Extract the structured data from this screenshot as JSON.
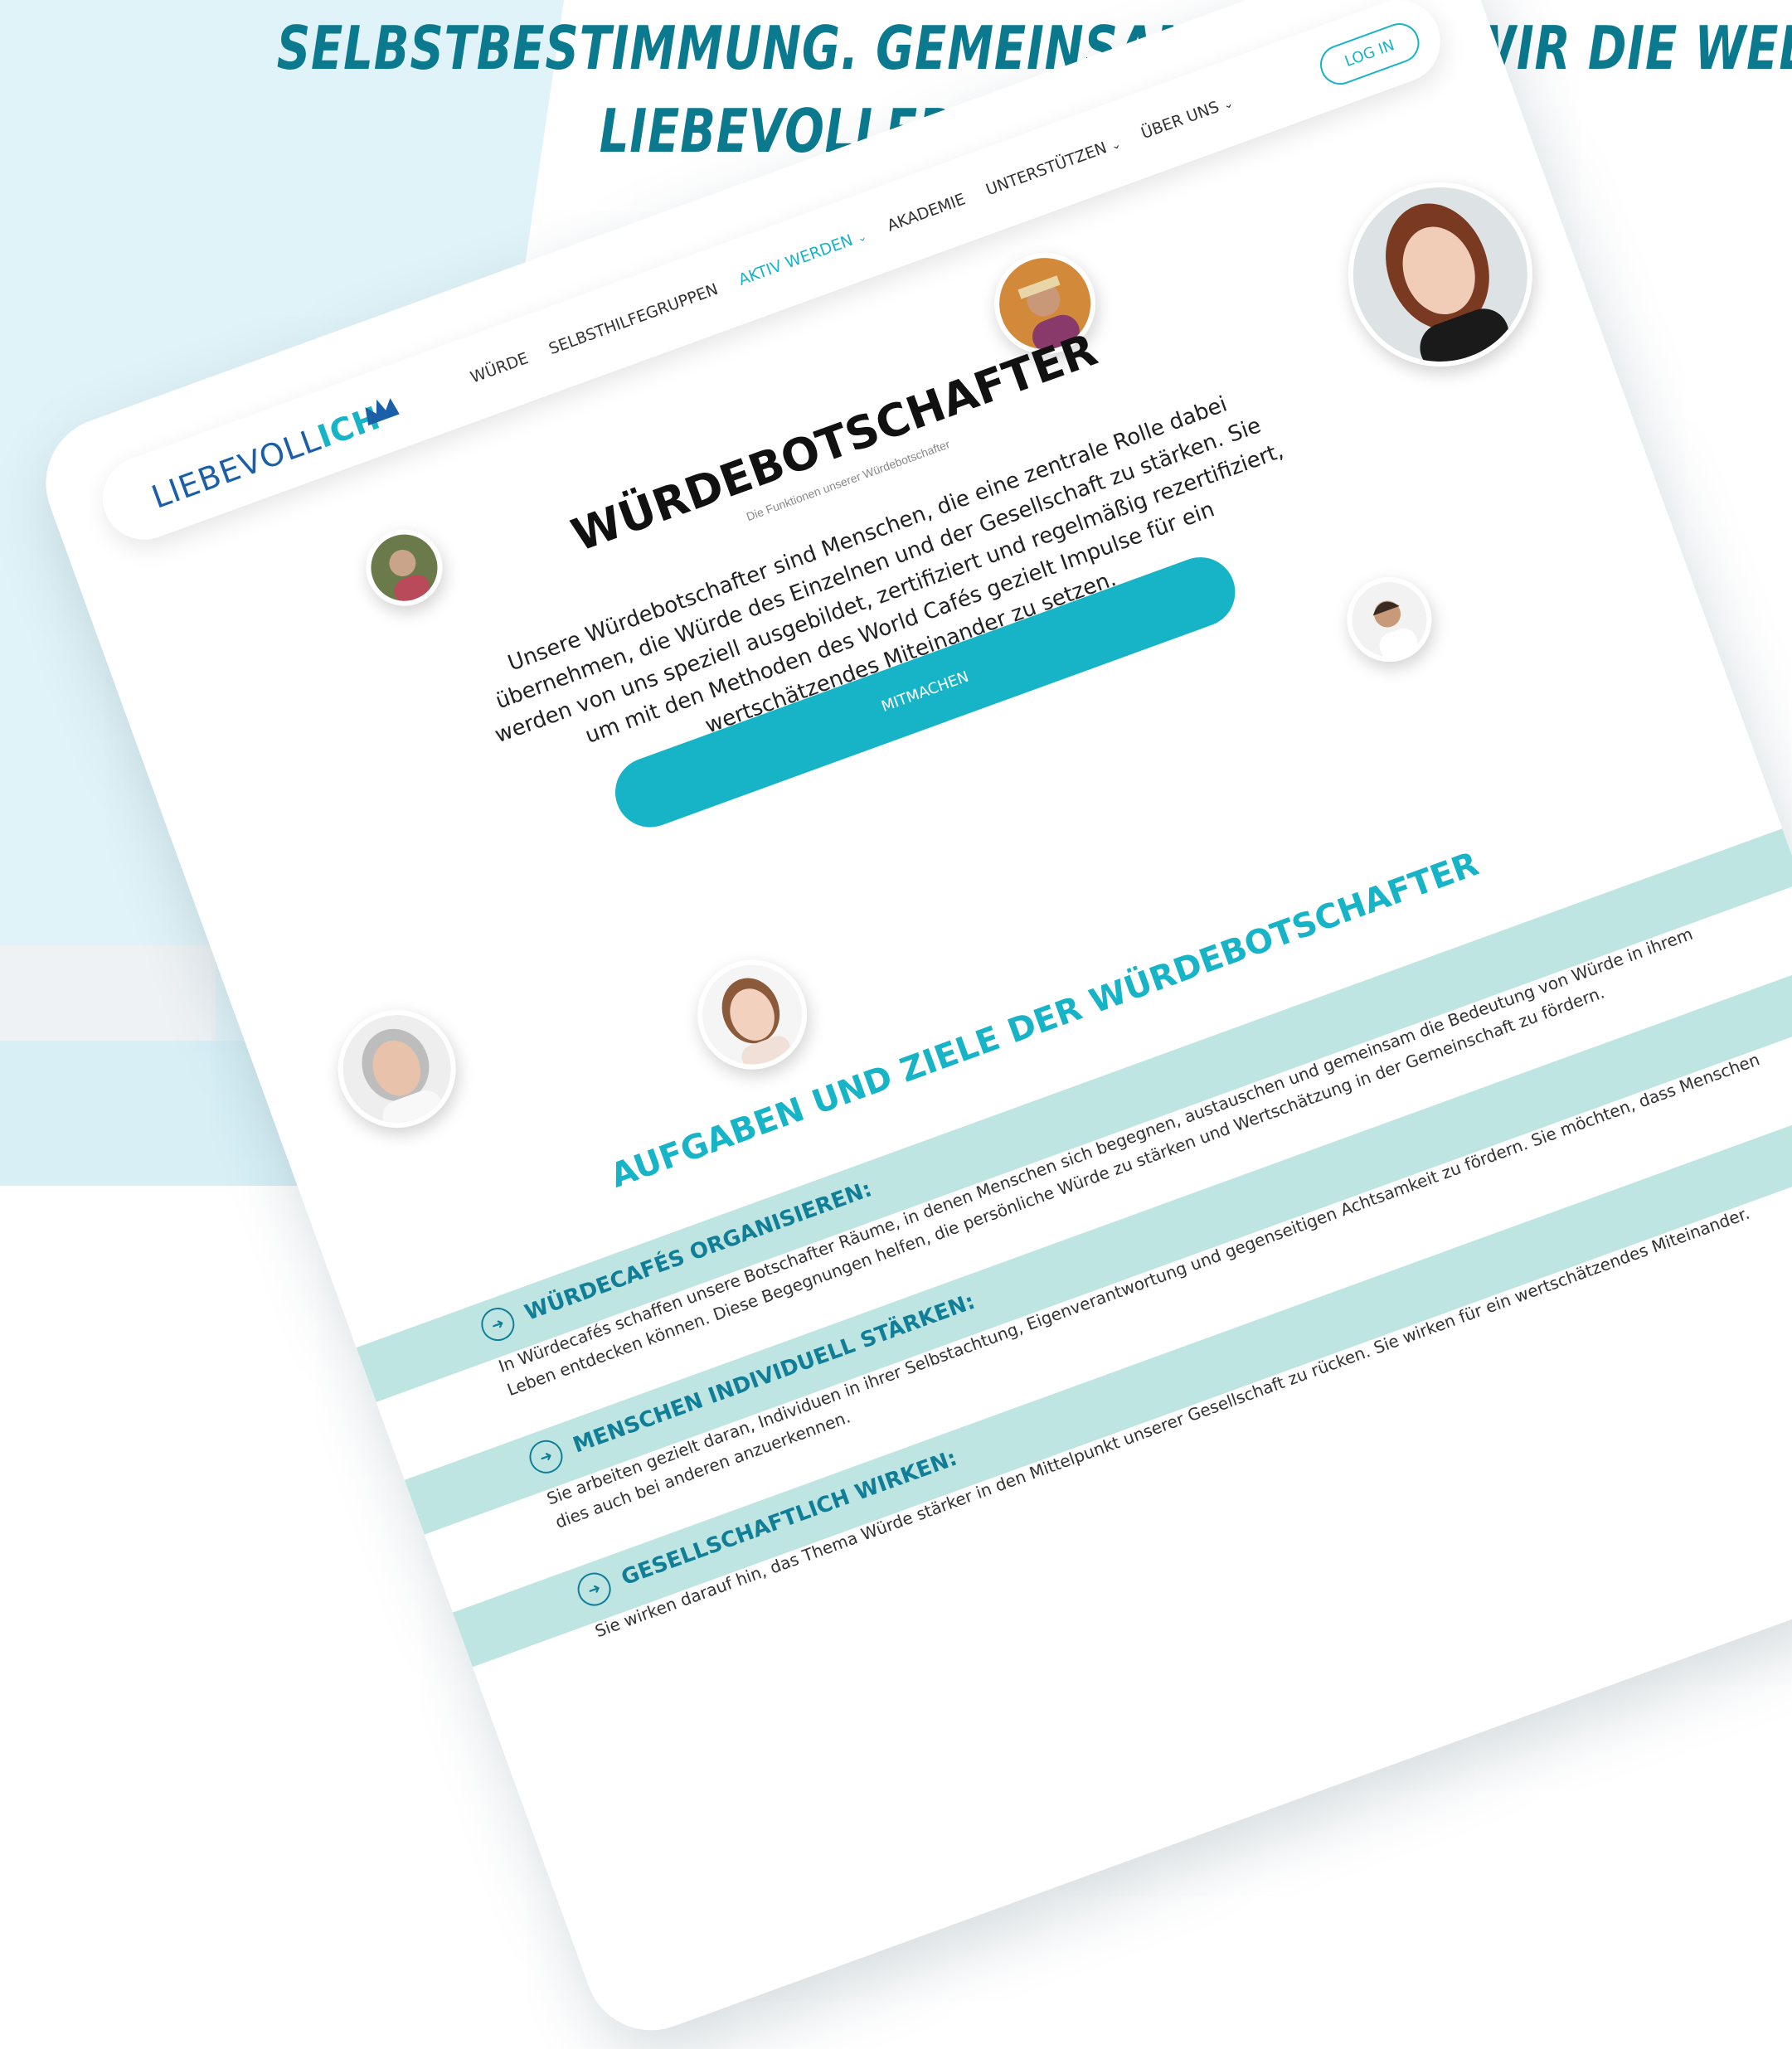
{
  "headline": {
    "line1": "SELBSTBESTIMMUNG. GEMEINSAM MACHEN WIR DIE WELT",
    "line2": "LIEBEVOLLER!"
  },
  "logo": {
    "part1": "LIEBEVOLL",
    "part2": "ICH"
  },
  "nav": {
    "items": [
      {
        "label": "WÜRDE"
      },
      {
        "label": "SELBSTHILFEGRUPPEN"
      },
      {
        "label": "AKTIV WERDEN",
        "dropdown": true,
        "active": true
      },
      {
        "label": "AKADEMIE"
      },
      {
        "label": "UNTERSTÜTZEN",
        "dropdown": true
      },
      {
        "label": "ÜBER UNS",
        "dropdown": true
      }
    ],
    "login": "LOG IN"
  },
  "hero": {
    "title": "WÜRDEBOTSCHAFTER",
    "subtitle": "Die Funktionen unserer Würdebotschafter",
    "intro": "Unsere Würdebotschafter sind Menschen, die eine zentrale Rolle dabei übernehmen, die Würde des Einzelnen und der Gesellschaft zu stärken. Sie werden von uns speziell ausgebildet, zertifiziert und regelmäßig rezertifiziert, um mit den Methoden des World Cafés gezielt Impulse für ein wertschätzendes Miteinander zu setzen.",
    "cta": "MITMACHEN"
  },
  "tasks": {
    "title": "AUFGABEN UND ZIELE DER WÜRDEBOTSCHAFTER",
    "items": [
      {
        "heading": "WÜRDECAFÉS ORGANISIEREN:",
        "body": "In Würdecafés schaffen unsere Botschafter Räume, in denen Menschen sich begegnen, austauschen und gemeinsam die Bedeutung von Würde in ihrem Leben entdecken können. Diese Begegnungen helfen, die persönliche Würde zu stärken und Wertschätzung in der Gemeinschaft zu fördern."
      },
      {
        "heading": "MENSCHEN INDIVIDUELL STÄRKEN:",
        "body": "Sie arbeiten gezielt daran, Individuen in ihrer Selbstachtung, Eigenverantwortung und gegenseitigen Achtsamkeit zu fördern. Sie möchten, dass Menschen dies auch bei anderen anzuerkennen."
      },
      {
        "heading": "GESELLSCHAFTLICH WIRKEN:",
        "body": "Sie wirken darauf hin, das Thema Würde stärker in den Mittelpunkt unserer Gesellschaft zu rücken. Sie wirken für ein wertschätzendes Miteinander."
      }
    ]
  },
  "colors": {
    "accent": "#17b3c7",
    "dark_accent": "#0b7a8f",
    "band": "#bfe5e3",
    "bg_light": "#e0f3f8"
  }
}
